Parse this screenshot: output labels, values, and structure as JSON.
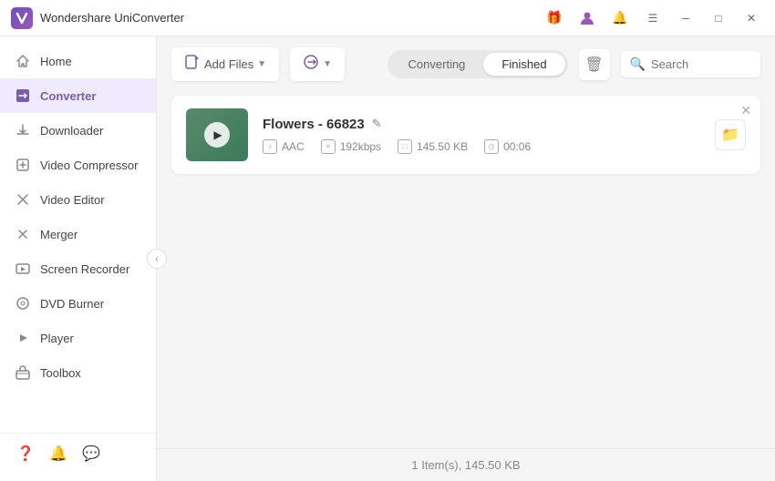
{
  "app": {
    "title": "Wondershare UniConverter",
    "logo_initial": "W"
  },
  "titlebar": {
    "gift_icon": "🎁",
    "user_icon": "👤",
    "bell_icon": "🔔",
    "menu_icon": "☰",
    "minimize_icon": "─",
    "maximize_icon": "□",
    "close_icon": "✕"
  },
  "sidebar": {
    "items": [
      {
        "id": "home",
        "label": "Home",
        "icon": "🏠",
        "active": false
      },
      {
        "id": "converter",
        "label": "Converter",
        "icon": "⬛",
        "active": true
      },
      {
        "id": "downloader",
        "label": "Downloader",
        "icon": "⬇",
        "active": false
      },
      {
        "id": "video-compressor",
        "label": "Video Compressor",
        "icon": "🗜",
        "active": false
      },
      {
        "id": "video-editor",
        "label": "Video Editor",
        "icon": "✂",
        "active": false
      },
      {
        "id": "merger",
        "label": "Merger",
        "icon": "🔗",
        "active": false
      },
      {
        "id": "screen-recorder",
        "label": "Screen Recorder",
        "icon": "🎬",
        "active": false
      },
      {
        "id": "dvd-burner",
        "label": "DVD Burner",
        "icon": "💿",
        "active": false
      },
      {
        "id": "player",
        "label": "Player",
        "icon": "▶",
        "active": false
      },
      {
        "id": "toolbox",
        "label": "Toolbox",
        "icon": "🧰",
        "active": false
      }
    ],
    "bottom_icons": [
      {
        "id": "help",
        "icon": "❓"
      },
      {
        "id": "notifications",
        "icon": "🔔"
      },
      {
        "id": "feedback",
        "icon": "💬"
      }
    ],
    "collapse_icon": "‹"
  },
  "toolbar": {
    "add_file_label": "Add Files",
    "add_file_icon": "📄",
    "convert_format_icon": "🔄",
    "tab_converting": "Converting",
    "tab_finished": "Finished",
    "trash_icon": "🗑",
    "search_placeholder": "Search",
    "search_icon": "🔍"
  },
  "files": [
    {
      "id": "flowers-66823",
      "name": "Flowers - 66823",
      "format": "AAC",
      "bitrate": "192kbps",
      "size": "145.50 KB",
      "duration": "00:06",
      "thumbnail_color_start": "#5a8a6a",
      "thumbnail_color_end": "#3a7a5a"
    }
  ],
  "status_bar": {
    "text": "1 Item(s), 145.50 KB"
  }
}
